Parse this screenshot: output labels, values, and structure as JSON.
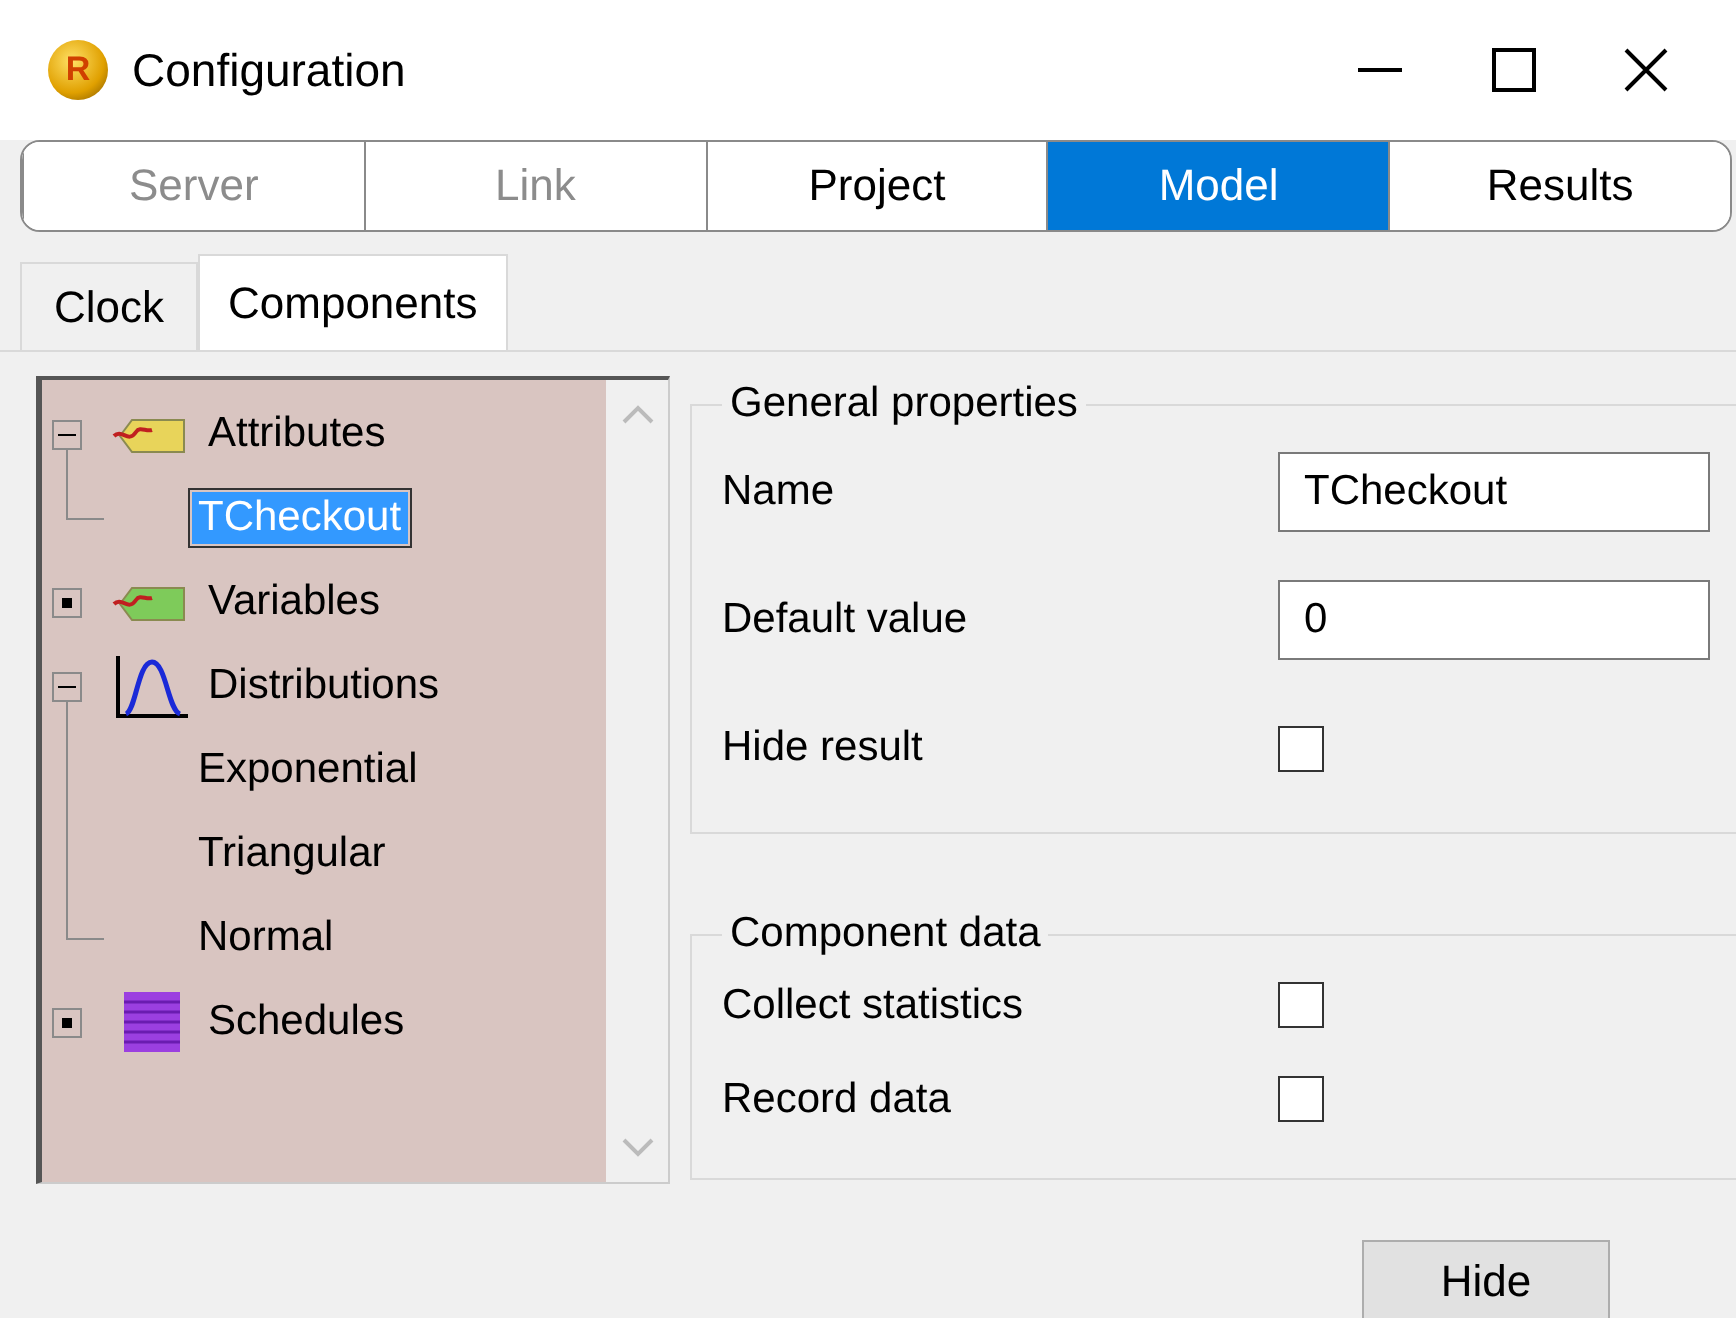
{
  "window": {
    "title": "Configuration",
    "logo": "R"
  },
  "tabs": [
    {
      "label": "Server",
      "selected": false,
      "disabled": true
    },
    {
      "label": "Link",
      "selected": false,
      "disabled": true
    },
    {
      "label": "Project",
      "selected": false,
      "disabled": false
    },
    {
      "label": "Model",
      "selected": true,
      "disabled": false
    },
    {
      "label": "Results",
      "selected": false,
      "disabled": false
    }
  ],
  "subtabs": [
    {
      "label": "Clock",
      "selected": false
    },
    {
      "label": "Components",
      "selected": true
    }
  ],
  "tree": {
    "items": [
      {
        "label": "Attributes",
        "kind": "tag-yellow",
        "expanded": true,
        "selected": false,
        "children": [
          {
            "label": "TCheckout",
            "selected": true
          }
        ]
      },
      {
        "label": "Variables",
        "kind": "tag-green",
        "expanded": false,
        "selected": false
      },
      {
        "label": "Distributions",
        "kind": "curve",
        "expanded": true,
        "selected": false,
        "children": [
          {
            "label": "Exponential",
            "selected": false
          },
          {
            "label": "Triangular",
            "selected": false
          },
          {
            "label": "Normal",
            "selected": false
          }
        ]
      },
      {
        "label": "Schedules",
        "kind": "stack",
        "expanded": false,
        "selected": false
      }
    ]
  },
  "general_properties": {
    "title": "General properties",
    "fields": [
      {
        "label": "Name",
        "kind": "text",
        "value": "TCheckout"
      },
      {
        "label": "Default value",
        "kind": "text",
        "value": "0"
      },
      {
        "label": "Hide result",
        "kind": "checkbox",
        "checked": false
      }
    ]
  },
  "component_data": {
    "title": "Component data",
    "fields": [
      {
        "label": "Collect statistics",
        "kind": "checkbox",
        "checked": false
      },
      {
        "label": "Record data",
        "kind": "checkbox",
        "checked": false
      }
    ]
  },
  "buttons": [
    {
      "label": "Hide"
    }
  ]
}
